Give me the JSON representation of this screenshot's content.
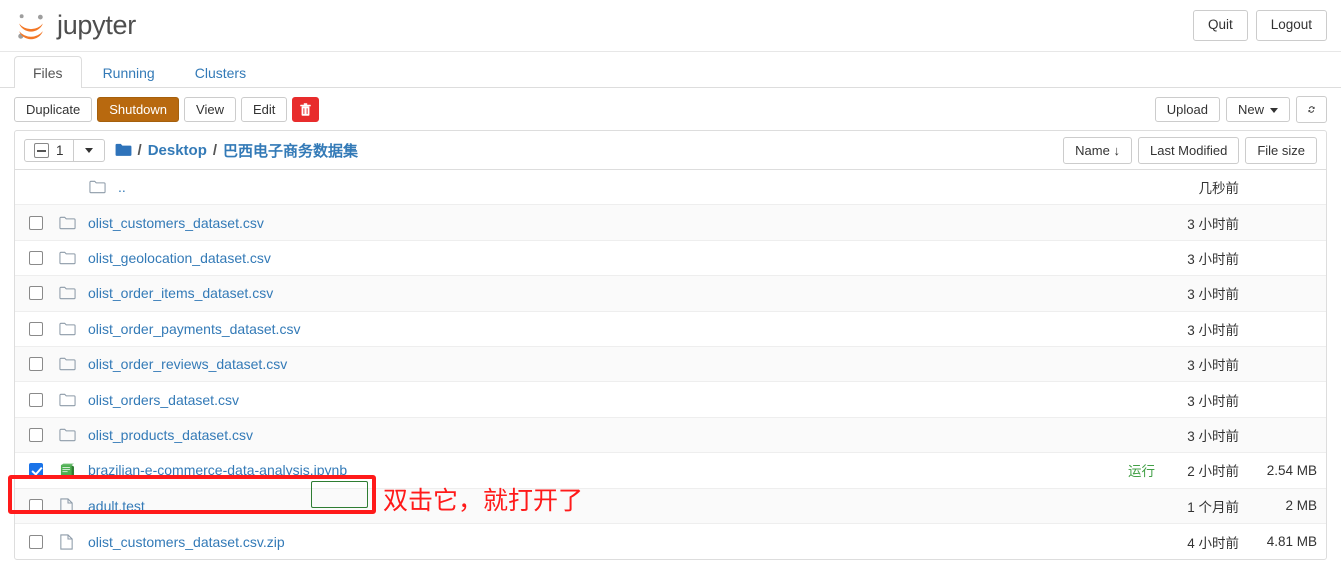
{
  "header": {
    "brand": "jupyter",
    "quit_label": "Quit",
    "logout_label": "Logout"
  },
  "tabs": [
    {
      "label": "Files",
      "active": true
    },
    {
      "label": "Running",
      "active": false
    },
    {
      "label": "Clusters",
      "active": false
    }
  ],
  "actionbar": {
    "duplicate_label": "Duplicate",
    "shutdown_label": "Shutdown",
    "view_label": "View",
    "edit_label": "Edit",
    "trash_icon": "trash-icon",
    "upload_label": "Upload",
    "new_label": "New",
    "refresh_icon": "refresh-icon"
  },
  "list_toolbar": {
    "selected_count": "1",
    "breadcrumb": [
      {
        "label": "folder-icon",
        "type": "icon"
      },
      {
        "label": "Desktop",
        "type": "link"
      },
      {
        "label": "巴西电子商务数据集",
        "type": "link"
      }
    ],
    "sort_name": "Name",
    "sort_name_arrow": "↓",
    "sort_last_modified": "Last Modified",
    "sort_file_size": "File size"
  },
  "files": [
    {
      "name": "..",
      "icon": "folder-icon",
      "checkbox": "none",
      "running": "",
      "modified": "几秒前",
      "size": ""
    },
    {
      "name": "olist_customers_dataset.csv",
      "icon": "folder-icon",
      "checkbox": "unchecked",
      "running": "",
      "modified": "3 小时前",
      "size": ""
    },
    {
      "name": "olist_geolocation_dataset.csv",
      "icon": "folder-icon",
      "checkbox": "unchecked",
      "running": "",
      "modified": "3 小时前",
      "size": ""
    },
    {
      "name": "olist_order_items_dataset.csv",
      "icon": "folder-icon",
      "checkbox": "unchecked",
      "running": "",
      "modified": "3 小时前",
      "size": ""
    },
    {
      "name": "olist_order_payments_dataset.csv",
      "icon": "folder-icon",
      "checkbox": "unchecked",
      "running": "",
      "modified": "3 小时前",
      "size": ""
    },
    {
      "name": "olist_order_reviews_dataset.csv",
      "icon": "folder-icon",
      "checkbox": "unchecked",
      "running": "",
      "modified": "3 小时前",
      "size": ""
    },
    {
      "name": "olist_orders_dataset.csv",
      "icon": "folder-icon",
      "checkbox": "unchecked",
      "running": "",
      "modified": "3 小时前",
      "size": ""
    },
    {
      "name": "olist_products_dataset.csv",
      "icon": "folder-icon",
      "checkbox": "unchecked",
      "running": "",
      "modified": "3 小时前",
      "size": ""
    },
    {
      "name": "brazilian-e-commerce-data-analysis.ipynb",
      "icon": "notebook-icon",
      "checkbox": "checked",
      "running": "运行",
      "modified": "2 小时前",
      "size": "2.54 MB"
    },
    {
      "name": "adult.test",
      "icon": "file-icon",
      "checkbox": "unchecked",
      "running": "",
      "modified": "1 个月前",
      "size": "2 MB"
    },
    {
      "name": "olist_customers_dataset.csv.zip",
      "icon": "file-icon",
      "checkbox": "unchecked",
      "running": "",
      "modified": "4 小时前",
      "size": "4.81 MB"
    }
  ],
  "annotations": {
    "instruction_text": "双击它，就打开了",
    "highlight_color": "#ff1a1a",
    "extension_box_color": "#2e7d32"
  },
  "colors": {
    "link": "#337ab7",
    "brand_orange": "#f37726",
    "checkbox_blue": "#1a73e8",
    "running_green": "#43a047",
    "shutdown_brown": "#b8690f",
    "trash_red": "#e82c2c"
  }
}
